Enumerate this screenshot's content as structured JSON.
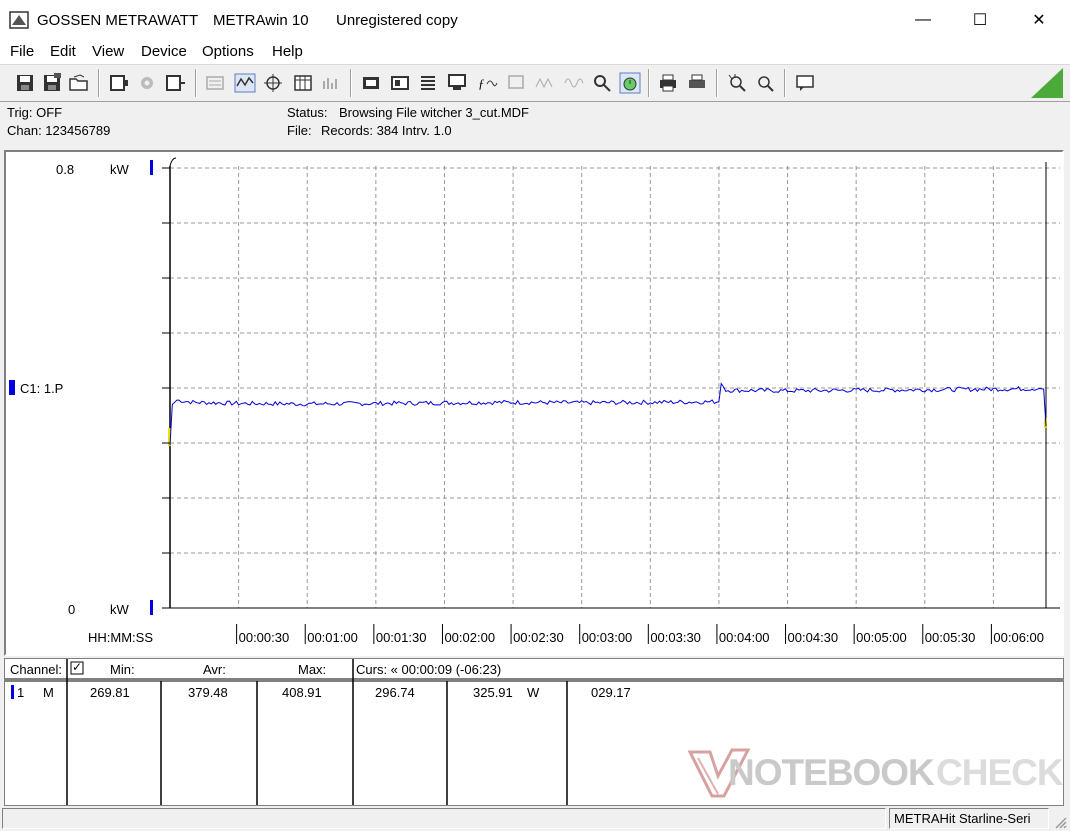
{
  "titlebar": {
    "vendor": "GOSSEN METRAWATT",
    "app": "METRAwin 10",
    "license": "Unregistered copy",
    "minimize": "—",
    "maximize": "☐",
    "close": "✕"
  },
  "menu": {
    "items": [
      {
        "label": "File"
      },
      {
        "label": "Edit"
      },
      {
        "label": "View"
      },
      {
        "label": "Device"
      },
      {
        "label": "Options"
      },
      {
        "label": "Help"
      }
    ]
  },
  "info": {
    "trig": "Trig: OFF",
    "chan": "Chan:  123456789",
    "status_label": "Status:",
    "status_value": "Browsing File witcher 3_cut.MDF",
    "file_label": "File:",
    "file_value": "Records: 384   Intrv. 1.0"
  },
  "chart": {
    "y_top_label": "0.8",
    "y_top_unit": "kW",
    "y_bottom_label": "0",
    "y_bottom_unit": "kW",
    "channel_label": "C1: 1.P",
    "time_format": "HH:MM:SS",
    "line_color": "#0000e0"
  },
  "chart_data": {
    "type": "line",
    "ylim": [
      0,
      0.8
    ],
    "ylabel": "kW",
    "xlabel": "HH:MM:SS",
    "x_ticks": [
      "00:00:30",
      "00:01:00",
      "00:01:30",
      "00:02:00",
      "00:02:30",
      "00:03:00",
      "00:03:30",
      "00:04:00",
      "00:04:30",
      "00:05:00",
      "00:05:30",
      "00:06:00"
    ],
    "grid": true,
    "series": [
      {
        "name": "C1: 1.P",
        "x_seconds": [
          0,
          1,
          3,
          10,
          30,
          60,
          90,
          120,
          150,
          180,
          210,
          240,
          241,
          242,
          243,
          270,
          300,
          330,
          360,
          380,
          382,
          383
        ],
        "values": [
          0.296,
          0.37,
          0.378,
          0.374,
          0.372,
          0.371,
          0.372,
          0.373,
          0.374,
          0.373,
          0.374,
          0.375,
          0.408,
          0.402,
          0.396,
          0.395,
          0.396,
          0.397,
          0.398,
          0.399,
          0.398,
          0.33
        ]
      }
    ]
  },
  "table": {
    "headers": {
      "channel": "Channel:",
      "check": "✓",
      "min": "Min:",
      "avr": "Avr:",
      "max": "Max:",
      "curs": "Curs: « 00:00:09 (-06:23)"
    },
    "row": {
      "num": "1",
      "mode": "M",
      "min": "269.81",
      "avr": "379.48",
      "max": "408.91",
      "curs1": "296.74",
      "curs2": "325.91",
      "unit": "W",
      "diff": "029.17"
    }
  },
  "statusbar": {
    "device": "METRAHit Starline-Seri"
  },
  "watermark": {
    "text_a": "NOTEBOOK",
    "text_b": "CHECK"
  }
}
